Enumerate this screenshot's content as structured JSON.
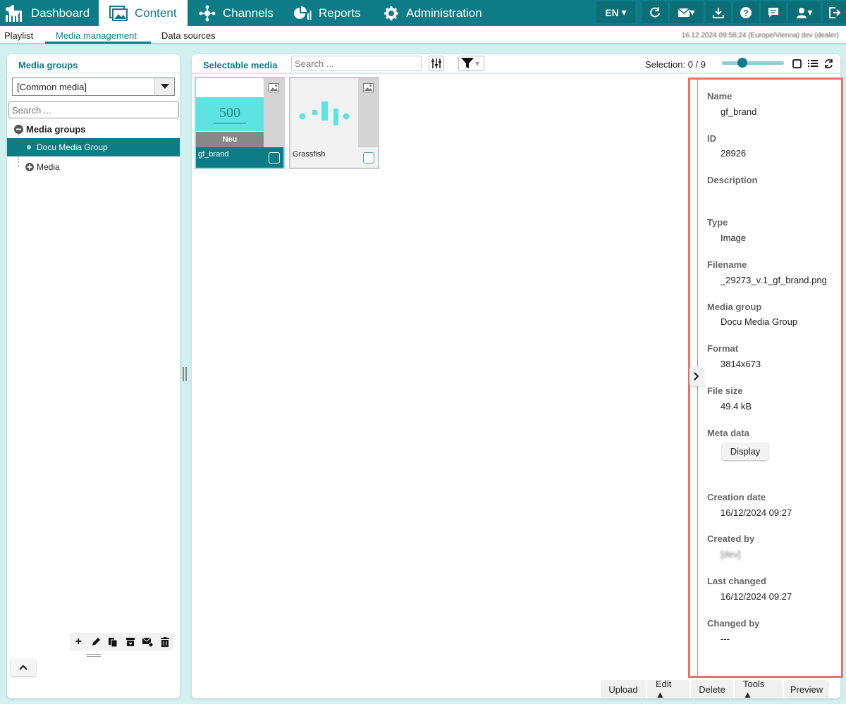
{
  "nav": {
    "tabs": [
      {
        "label": "Dashboard",
        "icon": "dashboard-icon"
      },
      {
        "label": "Content",
        "icon": "content-icon"
      },
      {
        "label": "Channels",
        "icon": "channels-icon"
      },
      {
        "label": "Reports",
        "icon": "reports-icon"
      },
      {
        "label": "Administration",
        "icon": "gear-icon"
      }
    ],
    "active_tab": "Content",
    "language": "EN",
    "accent": "#0e7c86"
  },
  "subnav": {
    "tabs": [
      "Playlist",
      "Media management",
      "Data sources"
    ],
    "active": "Media management",
    "status": "16.12.2024 09:58:24 (Europe/Vienna) dev (dealer)"
  },
  "left": {
    "title": "Media groups",
    "select_value": "[Common media]",
    "search_placeholder": "Search ...",
    "tree_root": "Media groups",
    "tree_selected": "Docu Media Group",
    "tree_media": "Media"
  },
  "main": {
    "title": "Selectable media",
    "search_placeholder": "Search ...",
    "selection_label": "Selection: 0 / 9",
    "thumb_size_fraction": 0.3,
    "cards": [
      {
        "name": "gf_brand",
        "badge": "Neu",
        "thumb_text": "500",
        "selected": true
      },
      {
        "name": "Grassfish",
        "selected": false
      }
    ]
  },
  "details": {
    "name_label": "Name",
    "name_value": "gf_brand",
    "id_label": "ID",
    "id_value": "28926",
    "description_label": "Description",
    "type_label": "Type",
    "type_value": "Image",
    "filename_label": "Filename",
    "filename_value": "_29273_v.1_gf_brand.png",
    "group_label": "Media group",
    "group_value": "Docu Media Group",
    "format_label": "Format",
    "format_value": "3814x673",
    "filesize_label": "File size",
    "filesize_value": "49.4 kB",
    "meta_label": "Meta data",
    "display_button": "Display",
    "created_label": "Creation date",
    "created_value": "16/12/2024 09:27",
    "createdby_label": "Created by",
    "createdby_value": "[dev]",
    "changed_label": "Last changed",
    "changed_value": "16/12/2024 09:27",
    "changedby_label": "Changed by",
    "changedby_value": "---"
  },
  "actions": {
    "upload": "Upload",
    "edit": "Edit ▲",
    "delete": "Delete",
    "tools": "Tools ▲",
    "preview": "Preview"
  }
}
